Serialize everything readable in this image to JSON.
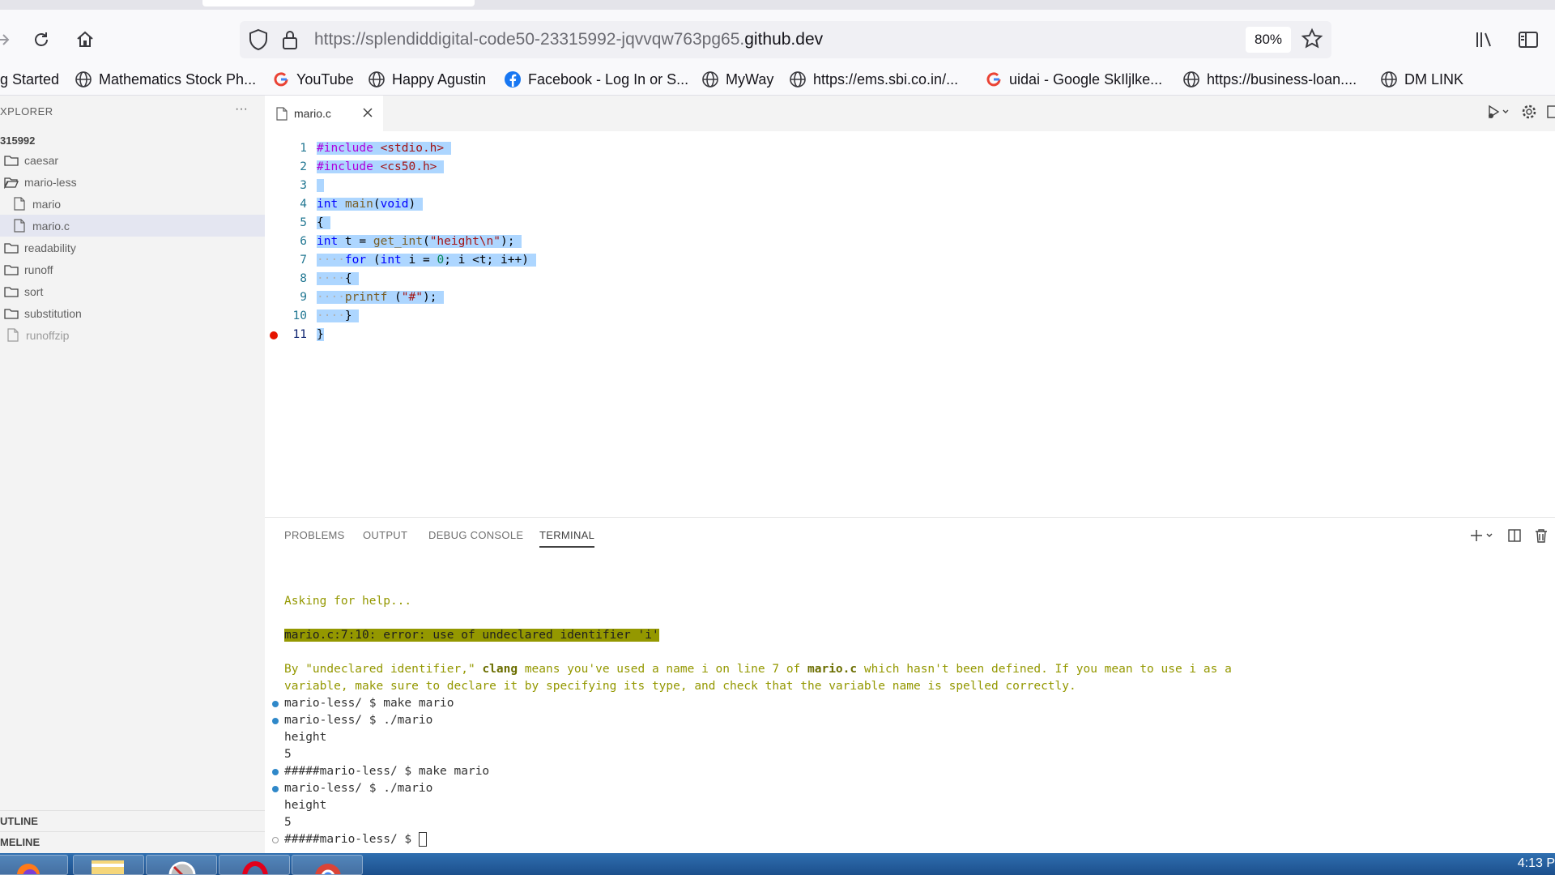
{
  "browser": {
    "url_prefix": "https://splendiddigital-code50-23315992-jqvvqw763pg65.",
    "url_domain": "github.dev",
    "zoom": "80%",
    "bookmarks": [
      "g Started",
      "Mathematics Stock Ph...",
      "YouTube",
      "Happy Agustin",
      "Facebook - Log In or S...",
      "MyWay",
      "https://ems.sbi.co.in/...",
      "uidai - Google SkIljlke...",
      "https://business-loan....",
      "DM LINK"
    ]
  },
  "sidebar": {
    "title": "XPLORER",
    "more": "···",
    "root": "315992",
    "items": [
      {
        "label": "caesar",
        "type": "folder"
      },
      {
        "label": "mario-less",
        "type": "folder-open"
      },
      {
        "label": "mario",
        "type": "file"
      },
      {
        "label": "mario.c",
        "type": "file"
      },
      {
        "label": "readability",
        "type": "folder"
      },
      {
        "label": "runoff",
        "type": "folder"
      },
      {
        "label": "sort",
        "type": "folder"
      },
      {
        "label": "substitution",
        "type": "folder"
      },
      {
        "label": "runoffzip",
        "type": "file"
      }
    ],
    "outline": "UTLINE",
    "timeline": "MELINE"
  },
  "editor": {
    "tab_label": "mario.c",
    "line_numbers": [
      "1",
      "2",
      "3",
      "4",
      "5",
      "6",
      "7",
      "8",
      "9",
      "10",
      "11"
    ]
  },
  "panel": {
    "tabs": [
      "PROBLEMS",
      "OUTPUT",
      "DEBUG CONSOLE",
      "TERMINAL"
    ],
    "terminal": {
      "asking": "Asking for help...",
      "error": "mario.c:7:10: error: use of undeclared identifier 'i'",
      "explain_1a": "By \"undeclared identifier,\" ",
      "explain_1b": "clang",
      "explain_1c": " means you've used a name i on line 7 of ",
      "explain_1d": "mario.c",
      "explain_1e": " which hasn't been defined. If you mean to use i as a",
      "explain_2": "variable, make sure to declare it by specifying its type, and check that the variable name is spelled correctly.",
      "lines": [
        "mario-less/ $ make mario",
        "mario-less/ $ ./mario",
        "height",
        "5",
        "#####mario-less/ $ make mario",
        "mario-less/ $ ./mario",
        "height",
        "5",
        "#####mario-less/ $ "
      ]
    }
  },
  "taskbar": {
    "clock": "4:13 P"
  }
}
